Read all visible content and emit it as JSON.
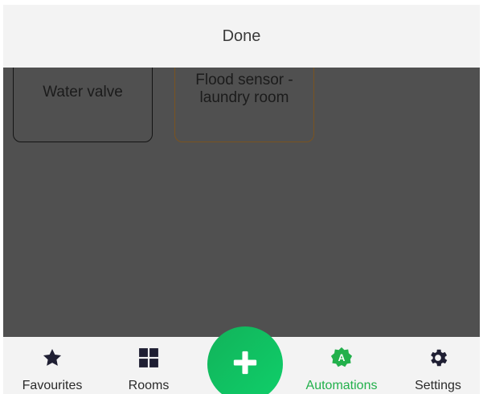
{
  "header": {
    "done_label": "Done"
  },
  "tiles": [
    {
      "label": "Water valve"
    },
    {
      "label": "Flood sensor -\nlaundry room"
    }
  ],
  "nav": {
    "items": [
      {
        "label": "Favourites",
        "icon": "star-icon"
      },
      {
        "label": "Rooms",
        "icon": "grid-icon"
      },
      {
        "label": "Automations",
        "icon": "automations-badge-icon",
        "active": true
      },
      {
        "label": "Settings",
        "icon": "gear-icon"
      }
    ],
    "fab_icon": "plus-icon",
    "automation_badge_letter": "A"
  },
  "colors": {
    "accent_green": "#22b04b",
    "fab_green": "#14c060",
    "overlay": "#505050",
    "bar_bg": "#f3f3f3"
  }
}
